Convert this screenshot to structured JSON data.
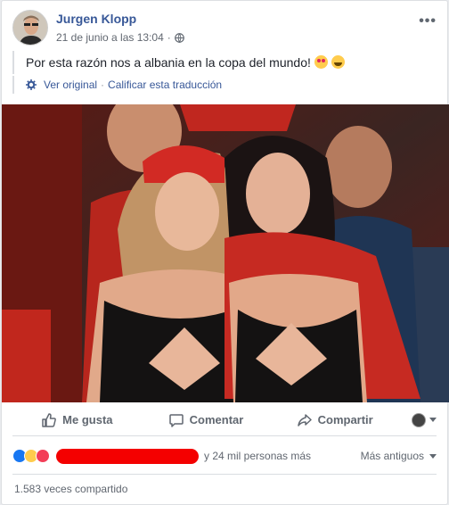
{
  "post": {
    "author": "Jurgen Klopp",
    "timestamp": "21 de junio a las 13:04",
    "text": "Por esta razón nos a albania en la copa del mundo!",
    "emojis": [
      "heart-eyes-emoji",
      "laugh-emoji"
    ],
    "see_original": "Ver original",
    "separator": "·",
    "rate_translation": "Calificar esta traducción",
    "more_menu": "•••"
  },
  "actions": {
    "like": "Me gusta",
    "comment": "Comentar",
    "share": "Compartir"
  },
  "reactions": {
    "types": [
      "like",
      "haha",
      "love"
    ],
    "others_text": "y 24 mil personas más",
    "order_label": "Más antiguos"
  },
  "shares": {
    "text": "1.583 veces compartido"
  },
  "colors": {
    "link": "#385898",
    "secondary": "#616770",
    "like_blue": "#1877f2",
    "love_red": "#f33e58",
    "redaction": "#f40000"
  }
}
